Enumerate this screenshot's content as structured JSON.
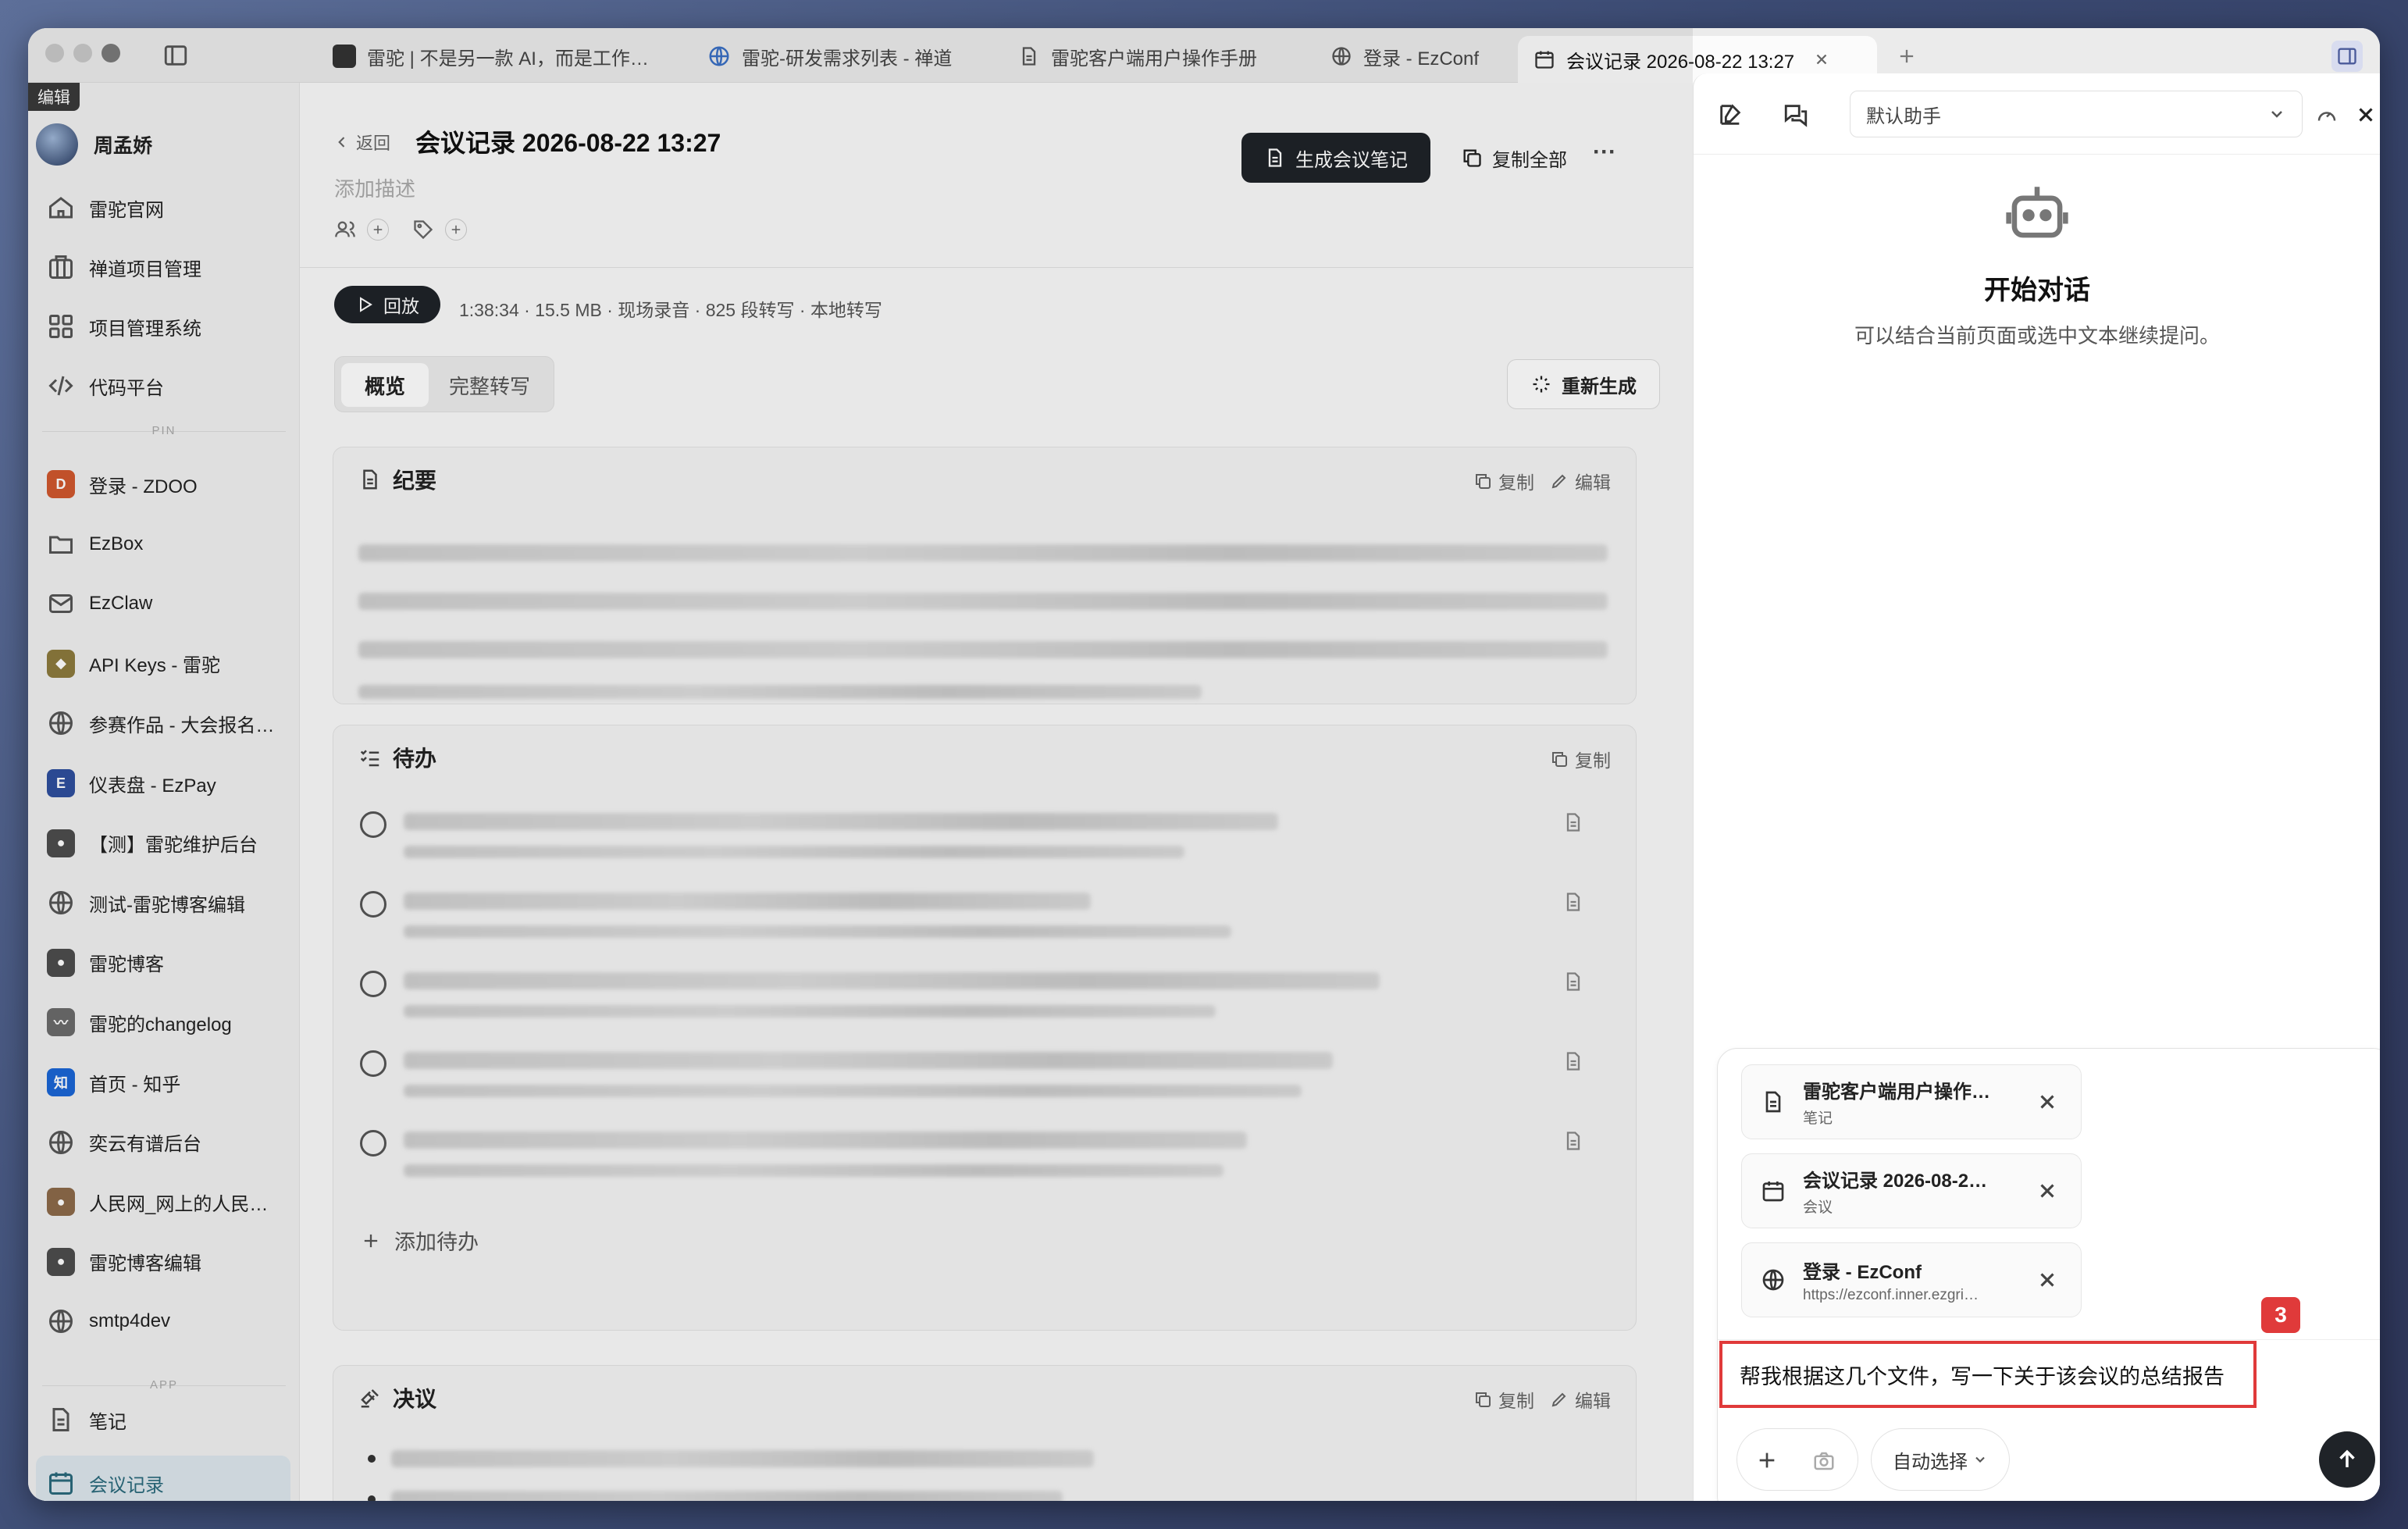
{
  "tabs": [
    {
      "label": "雷驼 | 不是另一款 AI，而是工作…",
      "icon": "app-icon"
    },
    {
      "label": "雷驼-研发需求列表 - 禅道",
      "icon": "globe-icon"
    },
    {
      "label": "雷驼客户端用户操作手册",
      "icon": "document-icon"
    },
    {
      "label": "登录 - EzConf",
      "icon": "globe-icon"
    },
    {
      "label": "会议记录 2026-08-22 13:27",
      "icon": "calendar-icon",
      "active": true
    }
  ],
  "sidebar": {
    "edit_tag": "编辑",
    "user_name": "周孟娇",
    "items": [
      {
        "label": "雷驼官网",
        "icon": "home-icon"
      },
      {
        "label": "禅道项目管理",
        "icon": "building-icon"
      },
      {
        "label": "项目管理系统",
        "icon": "grid-icon"
      },
      {
        "label": "代码平台",
        "icon": "code-icon"
      }
    ],
    "pin_label": "PIN",
    "pinned": [
      {
        "label": "登录 - ZDOO",
        "icon": "zdoo-icon",
        "color": "#d0582e"
      },
      {
        "label": "EzBox",
        "icon": "folder-icon"
      },
      {
        "label": "EzClaw",
        "icon": "mail-icon"
      },
      {
        "label": "API Keys - 雷驼",
        "icon": "shield-icon",
        "color": "#8c7a3d"
      },
      {
        "label": "参赛作品 - 大会报名…",
        "icon": "globe-icon"
      },
      {
        "label": "仪表盘 - EzPay",
        "icon": "ezpay-icon",
        "color": "#2f4f9e"
      },
      {
        "label": "【测】雷驼维护后台",
        "icon": "avatar-icon",
        "color": "#4d4d4d"
      },
      {
        "label": "测试-雷驼博客编辑",
        "icon": "globe-icon"
      },
      {
        "label": "雷驼博客",
        "icon": "avatar-icon",
        "color": "#4d4d4d"
      },
      {
        "label": "雷驼的changelog",
        "icon": "mustache-icon",
        "color": "#6b6b6b"
      },
      {
        "label": "首页 - 知乎",
        "icon": "zhihu-icon",
        "color": "#1a66d6"
      },
      {
        "label": "奕云有谱后台",
        "icon": "globe-icon"
      },
      {
        "label": "人民网_网上的人民…",
        "icon": "people-icon",
        "color": "#8c6a4a"
      },
      {
        "label": "雷驼博客编辑",
        "icon": "avatar-icon",
        "color": "#4d4d4d"
      },
      {
        "label": "smtp4dev",
        "icon": "globe-icon"
      }
    ],
    "app_label": "APP",
    "apps": [
      {
        "label": "笔记",
        "icon": "notes-icon"
      },
      {
        "label": "会议记录",
        "icon": "calendar-icon",
        "active": true
      }
    ]
  },
  "main": {
    "back_label": "返回",
    "title": "会议记录 2026-08-22 13:27",
    "desc_placeholder": "添加描述",
    "generate_btn": "生成会议笔记",
    "copy_all_btn": "复制全部",
    "more": "···",
    "play_btn": "回放",
    "meta": "1:38:34 · 15.5 MB · 现场录音 · 825 段转写 · 本地转写",
    "tabs": [
      "概览",
      "完整转写"
    ],
    "regenerate_btn": "重新生成",
    "summary": {
      "title": "纪要",
      "copy": "复制",
      "edit": "编辑"
    },
    "todos": {
      "title": "待办",
      "copy": "复制",
      "add": "添加待办"
    },
    "decisions": {
      "title": "决议",
      "copy": "复制",
      "edit": "编辑"
    }
  },
  "panel": {
    "assistant_select": "默认助手",
    "empty_title": "开始对话",
    "empty_subtitle": "可以结合当前页面或选中文本继续提问。",
    "attachments": [
      {
        "title": "雷驼客户端用户操作…",
        "sub": "笔记",
        "icon": "document-icon"
      },
      {
        "title": "会议记录 2026-08-2…",
        "sub": "会议",
        "icon": "calendar-icon"
      },
      {
        "title": "登录 - EzConf",
        "sub": "https://ezconf.inner.ezgri…",
        "icon": "globe-icon"
      }
    ],
    "badge": "3",
    "input_text": "帮我根据这几个文件，写一下关于该会议的总结报告",
    "model_select": "自动选择"
  },
  "colors": {
    "accent_dark": "#1f2328",
    "highlight_red": "#e03a3a",
    "active_teal": "#2a6a7c"
  }
}
